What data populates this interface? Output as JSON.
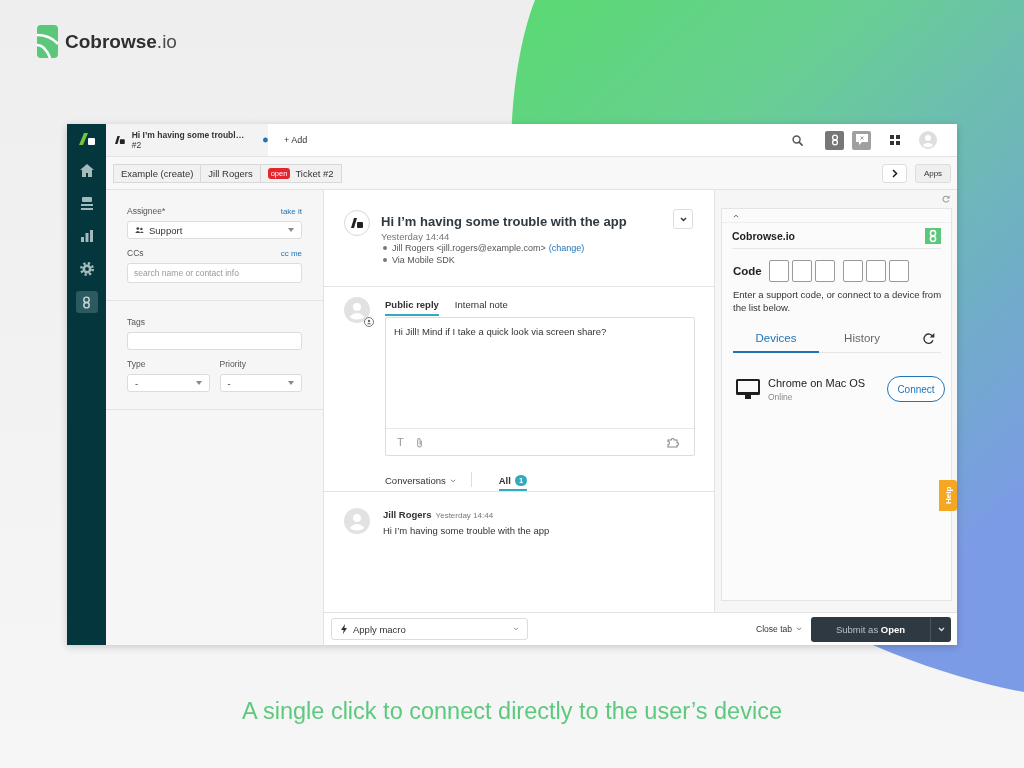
{
  "brand": {
    "name": "**Cobrowse**.io"
  },
  "nav": {
    "items": [
      {
        "kind": "home",
        "selected": false
      },
      {
        "kind": "views",
        "selected": false
      },
      {
        "kind": "reports",
        "selected": false
      },
      {
        "kind": "settings",
        "selected": false
      },
      {
        "kind": "app",
        "selected": true
      }
    ]
  },
  "top_bar": {
    "tabs": [
      {
        "title": "Hi I’m having some troubl…",
        "subtitle": "#2",
        "selected": true,
        "unread": true
      }
    ],
    "add": "+ Add"
  },
  "breadcrumbs": [
    {
      "label": "Example (create)"
    },
    {
      "label": "Jill Rogers"
    },
    {
      "badge": "open",
      "label": "Ticket #2"
    }
  ],
  "apps_button": "Apps",
  "properties": {
    "assignee": {
      "label": "Assignee*",
      "action": "take it",
      "value": "Support"
    },
    "ccs": {
      "label": "CCs",
      "action": "cc me",
      "placeholder": "search name or contact info"
    },
    "tags": {
      "label": "Tags"
    },
    "type": {
      "label": "Type",
      "value": "-"
    },
    "priority": {
      "label": "Priority",
      "value": "-"
    }
  },
  "ticket": {
    "title": "Hi I’m having some trouble with the app",
    "time": "Yesterday 14:44",
    "details": [
      {
        "text": "Jill Rogers <jill.rogers@example.com>",
        "link": "(change)"
      },
      {
        "text": "Via Mobile SDK"
      }
    ]
  },
  "reply": {
    "tabs": [
      {
        "label": "Public reply",
        "selected": true
      },
      {
        "label": "Internal note",
        "selected": false
      }
    ],
    "value": "Hi Jill! Mind if I take a quick look via screen share?",
    "format_glyph": "T"
  },
  "conversations_menu": "Conversations",
  "filter_tabs": [
    {
      "label": "All",
      "count": "1",
      "selected": true
    }
  ],
  "messages": [
    {
      "author": "Jill Rogers",
      "time": "Yesterday 14:44",
      "text": "Hi I’m having some trouble with the app"
    }
  ],
  "app_panel": {
    "title": "Cobrowse.io",
    "code_label": "Code",
    "hint": "Enter a support code, or connect to a device from the list below.",
    "tabs": [
      {
        "label": "Devices",
        "selected": true
      },
      {
        "label": "History",
        "selected": false
      }
    ],
    "devices": [
      {
        "name": "Chrome on Mac OS",
        "status": "Online",
        "action": "Connect"
      }
    ]
  },
  "help": "Help",
  "bottom_bar": {
    "macro": "Apply macro",
    "close_tab": "Close tab",
    "submit": "Submit as **Open**"
  },
  "caption": "A single click to connect directly to the user’s device"
}
